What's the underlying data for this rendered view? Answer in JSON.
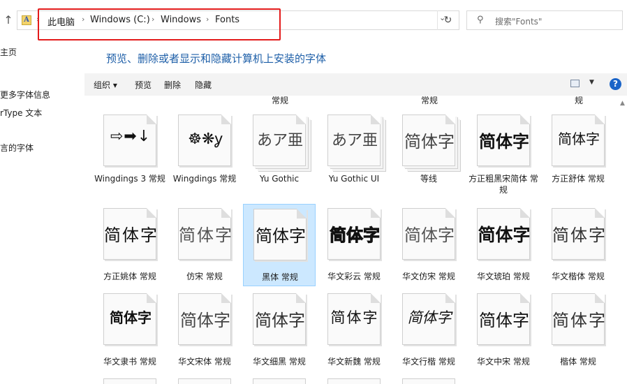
{
  "address_bar": {
    "app_icon_letter": "A",
    "breadcrumbs": [
      "此电脑",
      "Windows (C:)",
      "Windows",
      "Fonts"
    ],
    "separator": "›",
    "dropdown_glyph": "⌄",
    "refresh_glyph": "↻",
    "up_glyph": "↑"
  },
  "search": {
    "placeholder": "搜索\"Fonts\"",
    "icon_glyph": "⚲"
  },
  "left_pane": {
    "items": [
      "主页",
      "更多字体信息",
      "rType 文本",
      "言的字体"
    ]
  },
  "heading": "预览、删除或者显示和隐藏计算机上安装的字体",
  "toolbar": {
    "organize": "组织 ▾",
    "preview": "预览",
    "delete": "删除",
    "hide": "隐藏",
    "view_dd": "▼",
    "help": "?"
  },
  "cut_labels": [
    "常规",
    "常规",
    "规"
  ],
  "fonts": [
    {
      "label": "Wingdings 3 常规",
      "glyph": "⇨➡↓"
    },
    {
      "label": "Wingdings 常规",
      "glyph": "☸❋ỿ"
    },
    {
      "label": "Yu Gothic",
      "glyph": "あア亜"
    },
    {
      "label": "Yu Gothic UI",
      "glyph": "あア亜"
    },
    {
      "label": "等线",
      "glyph": "简体字"
    },
    {
      "label": "方正粗黑宋简体 常规",
      "glyph": "简体字"
    },
    {
      "label": "方正舒体 常规",
      "glyph": "简体字"
    },
    {
      "label": "方正姚体 常规",
      "glyph": "简体字"
    },
    {
      "label": "仿宋 常规",
      "glyph": "简体字"
    },
    {
      "label": "黑体 常规",
      "glyph": "简体字"
    },
    {
      "label": "华文彩云 常规",
      "glyph": "简体字"
    },
    {
      "label": "华文仿宋 常规",
      "glyph": "简体字"
    },
    {
      "label": "华文琥珀 常规",
      "glyph": "简体字"
    },
    {
      "label": "华文楷体 常规",
      "glyph": "简体字"
    },
    {
      "label": "华文隶书 常规",
      "glyph": "简体字"
    },
    {
      "label": "华文宋体 常规",
      "glyph": "简体字"
    },
    {
      "label": "华文细黑 常规",
      "glyph": "简体字"
    },
    {
      "label": "华文新魏 常规",
      "glyph": "简体字"
    },
    {
      "label": "华文行楷 常规",
      "glyph": "简体字"
    },
    {
      "label": "华文中宋 常规",
      "glyph": "简体字"
    },
    {
      "label": "楷体 常规",
      "glyph": "简体字"
    }
  ],
  "colors": {
    "highlight": "#e31b1b",
    "selection": "#cce8ff",
    "heading": "#1e5fa8",
    "help": "#1a64c8"
  }
}
